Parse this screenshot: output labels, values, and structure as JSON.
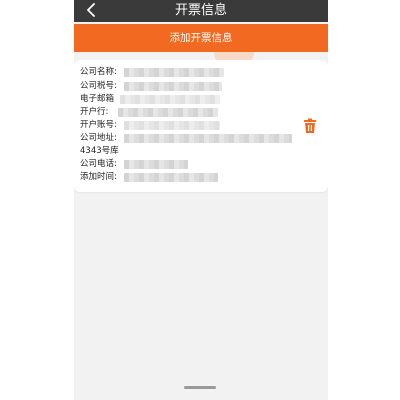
{
  "navbar": {
    "title": "开票信息",
    "back_icon": "chevron-left-icon"
  },
  "actions": {
    "add_label": "添加开票信息"
  },
  "invoice": {
    "fields": [
      {
        "label": "公司名称:"
      },
      {
        "label": "公司税号:"
      },
      {
        "label": "电子邮箱"
      },
      {
        "label": "开户行:"
      },
      {
        "label": "开户账号:"
      },
      {
        "label": "公司地址:"
      },
      {
        "label": "4343号库"
      },
      {
        "label": "公司电话:"
      },
      {
        "label": "添加时间:"
      }
    ],
    "delete_icon": "trash-icon"
  },
  "colors": {
    "accent": "#f26a21",
    "navbar_bg": "#3a3a3a",
    "page_bg": "#f2f2f2"
  }
}
